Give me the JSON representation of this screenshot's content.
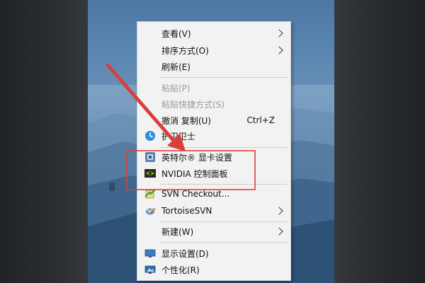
{
  "menu": {
    "items": [
      {
        "label": "查看(V)",
        "submenu": true
      },
      {
        "label": "排序方式(O)",
        "submenu": true
      },
      {
        "label": "刷新(E)"
      },
      {
        "label": "粘贴(P)",
        "disabled": true
      },
      {
        "label": "粘贴快捷方式(S)",
        "disabled": true
      },
      {
        "label": "撤消 复制(U)",
        "shortcut": "Ctrl+Z"
      },
      {
        "label": "护卫卫士",
        "icon": "security-guard-icon"
      },
      {
        "label": "英特尔® 显卡设置",
        "icon": "intel-graphics-icon"
      },
      {
        "label": "NVIDIA 控制面板",
        "icon": "nvidia-icon"
      },
      {
        "label": "SVN Checkout...",
        "icon": "svn-checkout-icon"
      },
      {
        "label": "TortoiseSVN",
        "icon": "tortoisesvn-icon",
        "submenu": true
      },
      {
        "label": "新建(W)",
        "submenu": true
      },
      {
        "label": "显示设置(D)",
        "icon": "display-settings-icon"
      },
      {
        "label": "个性化(R)",
        "icon": "personalize-icon"
      }
    ]
  },
  "annotation": {
    "color": "#d9403d"
  }
}
